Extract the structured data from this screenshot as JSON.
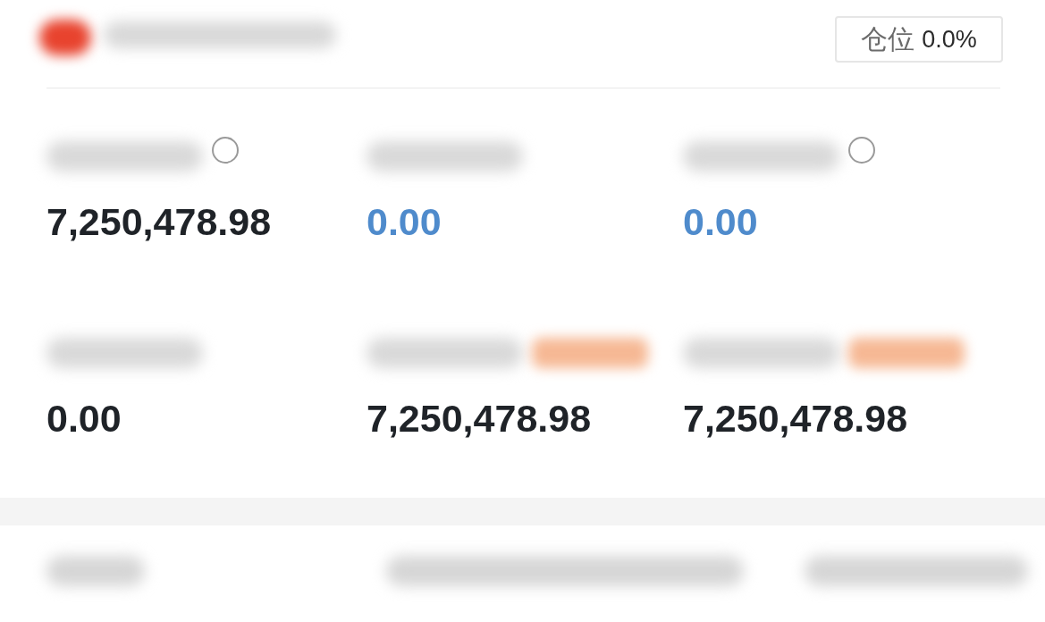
{
  "header": {
    "position_button": {
      "label": "仓位",
      "value": "0.0%"
    }
  },
  "metrics": [
    {
      "value": "7,250,478.98",
      "color": "#1f2328",
      "info_icon": true,
      "tag": false
    },
    {
      "value": "0.00",
      "color": "#4f8bcc",
      "info_icon": false,
      "tag": false
    },
    {
      "value": "0.00",
      "color": "#4f8bcc",
      "info_icon": true,
      "tag": false
    },
    {
      "value": "0.00",
      "color": "#1f2328",
      "info_icon": false,
      "tag": false
    },
    {
      "value": "7,250,478.98",
      "color": "#1f2328",
      "info_icon": false,
      "tag": true
    },
    {
      "value": "7,250,478.98",
      "color": "#1f2328",
      "info_icon": false,
      "tag": true
    }
  ]
}
